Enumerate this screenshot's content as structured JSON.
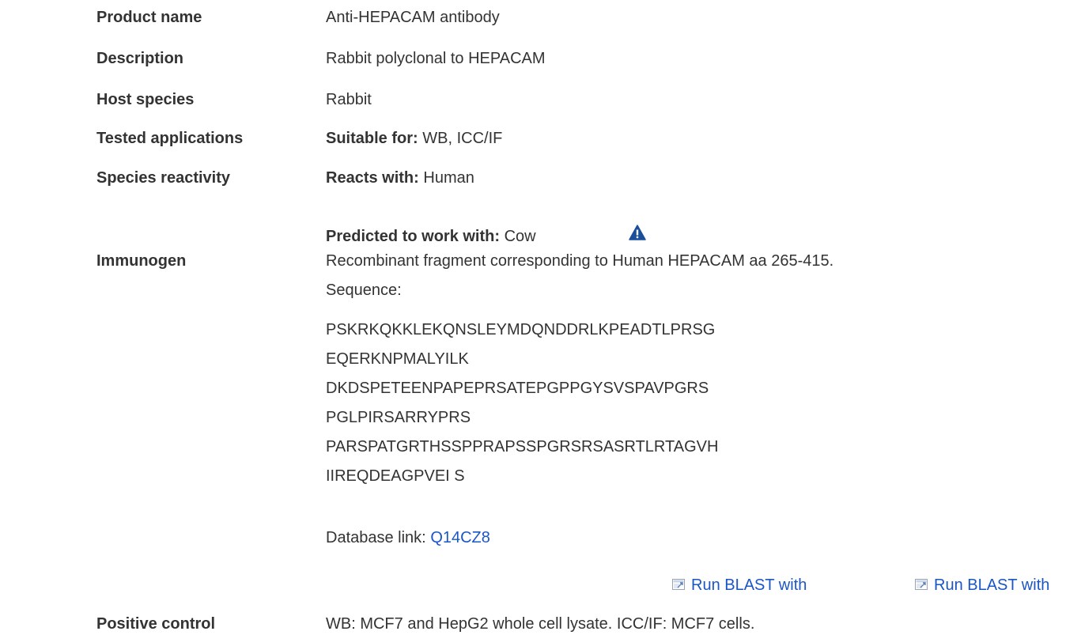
{
  "rows": {
    "product_name": {
      "label": "Product name",
      "value": "Anti-HEPACAM antibody"
    },
    "description": {
      "label": "Description",
      "value": "Rabbit polyclonal to HEPACAM"
    },
    "host_species": {
      "label": "Host species",
      "value": "Rabbit"
    },
    "tested_applications": {
      "label": "Tested applications",
      "prefix": "Suitable for:",
      "value": "WB, ICC/IF"
    },
    "species_reactivity": {
      "label": "Species reactivity",
      "reacts_prefix": "Reacts with:",
      "reacts_value": "Human",
      "predicted_prefix": "Predicted to work with:",
      "predicted_value": "Cow"
    },
    "immunogen": {
      "label": "Immunogen",
      "value": "Recombinant fragment corresponding to Human HEPACAM aa 265-415.",
      "sequence_label": "Sequence:",
      "sequence_lines": [
        "PSKRKQKKLEKQNSLEYMDQNDDRLKPEADTLPRSG",
        "EQERKNPMALYILK",
        "DKDSPETEENPAPEPRSATEPGPPGYSVSPAVPGRS",
        "PGLPIRSARRYPRS",
        "PARSPATGRTHSSPPRAPSSPGRSRSASRTLRTAGVH",
        "IIREQDEAGPVEI S"
      ],
      "database_label": "Database link:",
      "database_link": "Q14CZ8",
      "blast_1": "Run BLAST with",
      "blast_2": "Run BLAST with"
    },
    "positive_control": {
      "label": "Positive control",
      "value": "WB: MCF7 and HepG2 whole cell lysate. ICC/IF: MCF7 cells."
    }
  },
  "colors": {
    "text": "#333333",
    "link": "#1a56c4",
    "warning": "#1a4f9c"
  },
  "icons": [
    "warning-triangle-icon",
    "external-link-icon"
  ]
}
